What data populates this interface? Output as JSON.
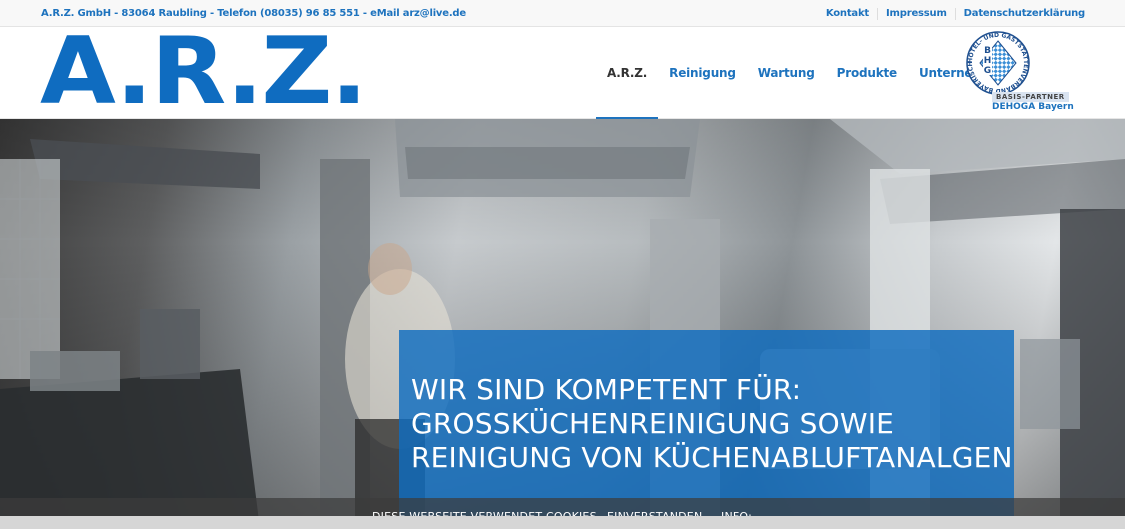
{
  "topbar": {
    "contact": "A.R.Z. GmbH - 83064 Raubling - Telefon (08035) 96 85 551 - eMail arz@live.de",
    "links": [
      "Kontakt",
      "Impressum",
      "Datenschutzerklärung"
    ]
  },
  "header": {
    "logo_text": "A.R.Z.",
    "nav": [
      "A.R.Z.",
      "Reinigung",
      "Wartung",
      "Produkte",
      "Unternehmen"
    ],
    "active_nav": "A.R.Z.",
    "partner": {
      "badge_letters": "BHG",
      "ring_text": "HOTEL- UND GASTSTÄTTENVERBAND BAYERISCHER",
      "label": "BASIS-PARTNER",
      "org": "DEHOGA Bayern"
    }
  },
  "hero": {
    "headline_lines": [
      "WIR SIND KOMPETENT FÜR:",
      "GROSSKÜCHENREINIGUNG SOWIE",
      "REINIGUNG VON KÜCHENABLUFTANALGEN"
    ]
  },
  "cookie_bar": {
    "text": "DIESE WEBSEITE VERWENDET COOKIES.",
    "accept": "EINVERSTANDEN.",
    "info": "INFO:"
  },
  "colors": {
    "brand_blue": "#0f6cc0",
    "link_blue": "#1e73be",
    "overlay_blue": "rgba(15,108,192,0.82)"
  }
}
